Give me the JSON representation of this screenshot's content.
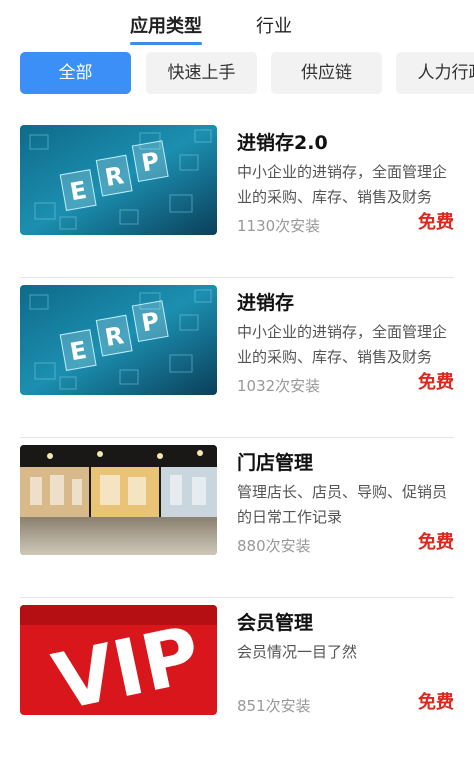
{
  "top_tabs": [
    {
      "label": "应用类型",
      "active": true
    },
    {
      "label": "行业",
      "active": false
    }
  ],
  "filter_chips": [
    {
      "label": "全部",
      "active": true
    },
    {
      "label": "快速上手",
      "active": false
    },
    {
      "label": "供应链",
      "active": false
    },
    {
      "label": "人力行政",
      "active": false
    }
  ],
  "apps": [
    {
      "title": "进销存2.0",
      "description": "中小企业的进销存，全面管理企业的采购、库存、销售及财务",
      "installs": "1130次安装",
      "price": "免费",
      "thumb_text": "ERP"
    },
    {
      "title": "进销存",
      "description": "中小企业的进销存，全面管理企业的采购、库存、销售及财务",
      "installs": "1032次安装",
      "price": "免费",
      "thumb_text": "ERP"
    },
    {
      "title": "门店管理",
      "description": "管理店长、店员、导购、促销员的日常工作记录",
      "installs": "880次安装",
      "price": "免费"
    },
    {
      "title": "会员管理",
      "description": "会员情况一目了然",
      "installs": "851次安装",
      "price": "免费",
      "thumb_text": "VIP"
    }
  ],
  "colors": {
    "accent": "#3b8ff6",
    "price": "#e0261b"
  }
}
